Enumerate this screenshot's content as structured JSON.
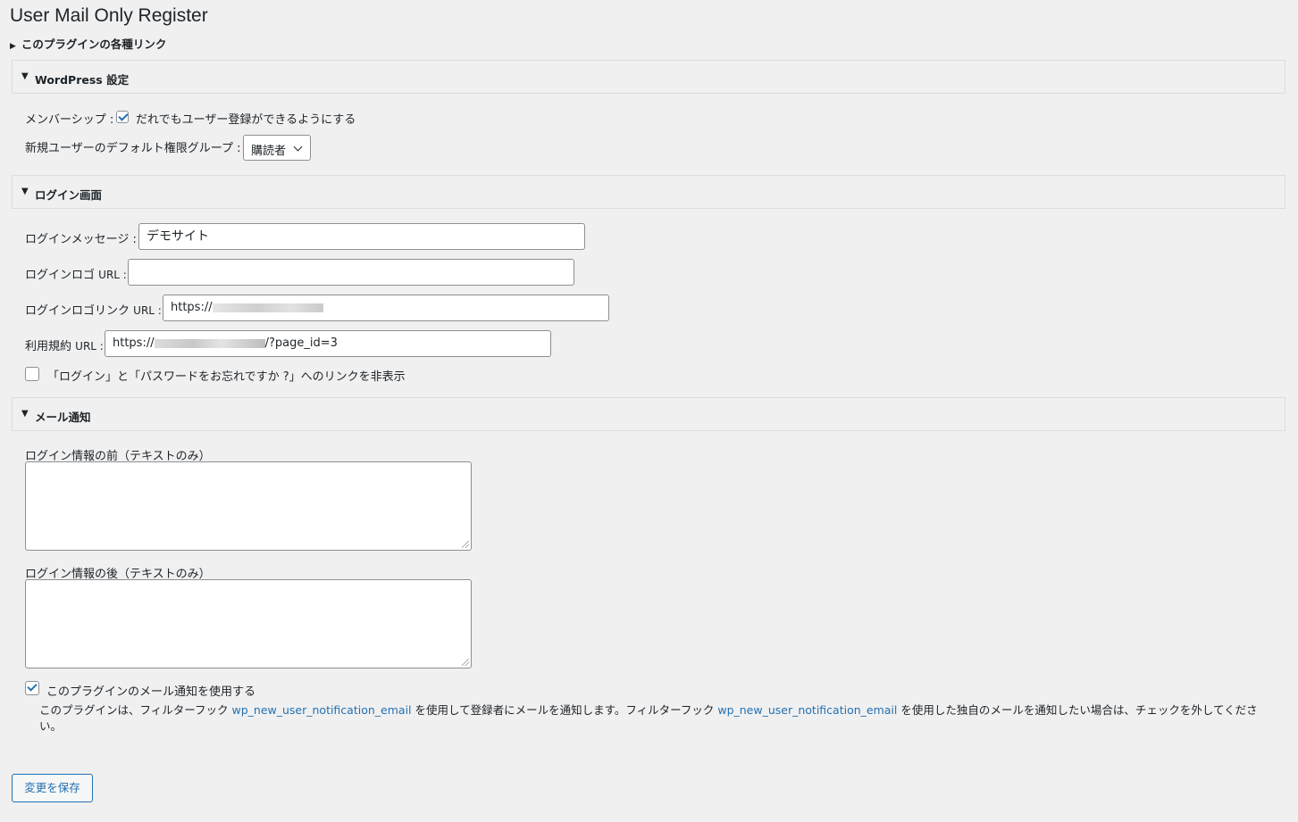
{
  "page_title": "User Mail Only Register",
  "links_toggle": "このプラグインの各種リンク",
  "sections": {
    "wordpress": {
      "title": "WordPress 設定"
    },
    "login": {
      "title": "ログイン画面"
    },
    "mail": {
      "title": "メール通知"
    }
  },
  "wordpress": {
    "membership_label": "メンバーシップ :",
    "membership_checkbox_label": "だれでもユーザー登録ができるようにする",
    "membership_checked": true,
    "default_role_label": "新規ユーザーのデフォルト権限グループ :",
    "default_role_value": "購読者"
  },
  "login": {
    "message_label": "ログインメッセージ :",
    "message_value": "デモサイト",
    "logo_url_label": "ログインロゴ",
    "logo_url_suffix": "URL :",
    "logo_url_value": "",
    "logo_link_label": "ログインロゴリンク",
    "logo_link_suffix": "URL :",
    "logo_link_value": "https://",
    "terms_label": "利用規約",
    "terms_suffix": "URL :",
    "terms_value_prefix": "https://",
    "terms_value_suffix": "/?page_id=3",
    "hide_links_label": "「ログイン」と「パスワードをお忘れですか ?」へのリンクを非表示",
    "hide_links_checked": false
  },
  "mail": {
    "before_label": "ログイン情報の前（テキストのみ）",
    "after_label": "ログイン情報の後（テキストのみ）",
    "use_notification_label": "このプラグインのメール通知を使用する",
    "use_notification_checked": true,
    "desc_1": "このプラグインは、フィルターフック ",
    "hook_name": "wp_new_user_notification_email",
    "desc_2": " を使用して登録者にメールを通知します。フィルターフック ",
    "desc_3": " を使用した独自のメールを通知したい場合は、チェックを外してください。"
  },
  "save_button": "変更を保存",
  "colors": {
    "background": "#f0f0f1",
    "accent": "#2271b1",
    "border": "#8c8f94"
  }
}
